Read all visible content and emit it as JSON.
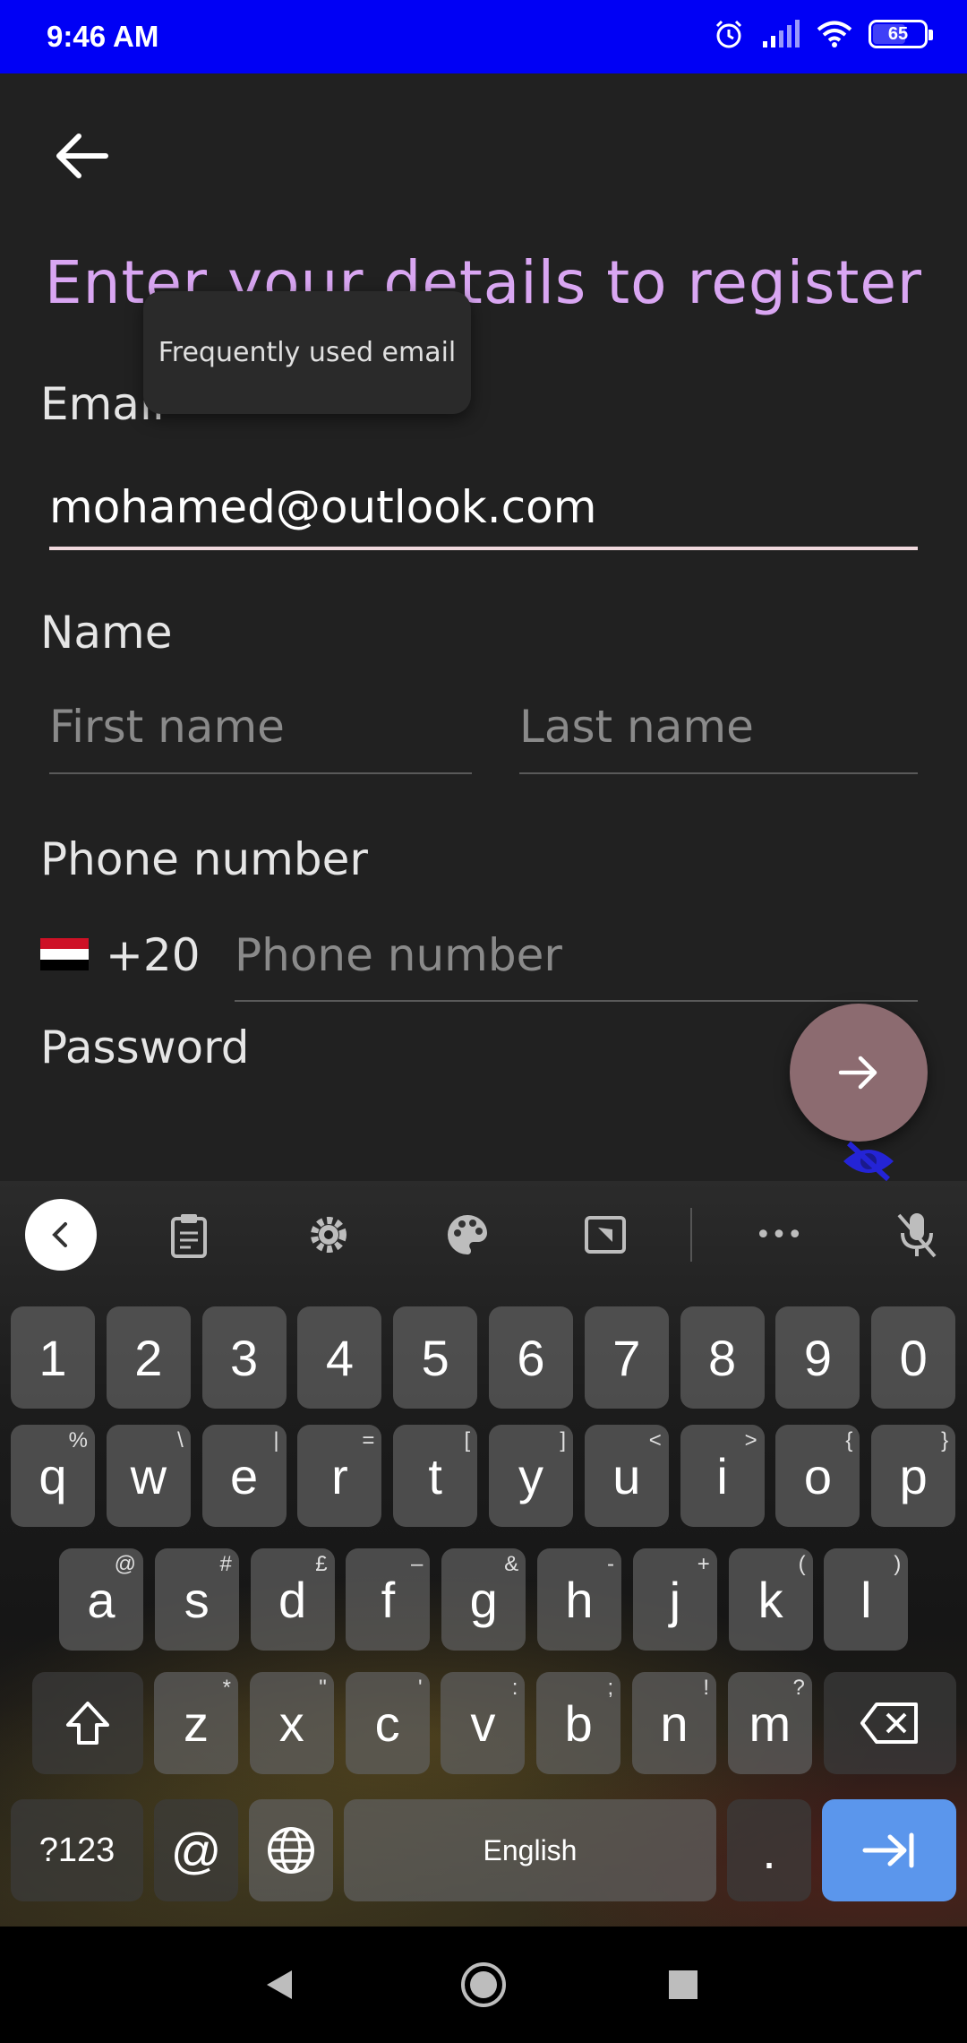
{
  "status_bar": {
    "time": "9:46 AM",
    "battery": "65",
    "battery_level": 0.65,
    "icons": [
      "alarm-icon",
      "signal-icon",
      "wifi-icon",
      "battery-icon"
    ]
  },
  "form": {
    "title": "Enter your details to register",
    "email_label": "Email",
    "email_value": "mohamed@outlook.com",
    "suggestion": "Frequently used email",
    "name_label": "Name",
    "first_name_placeholder": "First name",
    "last_name_placeholder": "Last name",
    "phone_label": "Phone number",
    "country_code": "+20",
    "phone_placeholder": "Phone number",
    "password_label": "Password",
    "colors": {
      "title": "#d9a6f2",
      "fab": "#8c6b70",
      "eye": "#2424d6"
    }
  },
  "keyboard": {
    "toolbar_icons": [
      "collapse-icon",
      "clipboard-icon",
      "settings-icon",
      "palette-icon",
      "resize-icon",
      "more-icon",
      "mic-off-icon"
    ],
    "more_label": "•••",
    "row_numbers": [
      "1",
      "2",
      "3",
      "4",
      "5",
      "6",
      "7",
      "8",
      "9",
      "0"
    ],
    "row1": [
      {
        "k": "q",
        "h": "%"
      },
      {
        "k": "w",
        "h": "\\"
      },
      {
        "k": "e",
        "h": "|"
      },
      {
        "k": "r",
        "h": "="
      },
      {
        "k": "t",
        "h": "["
      },
      {
        "k": "y",
        "h": "]"
      },
      {
        "k": "u",
        "h": "<"
      },
      {
        "k": "i",
        "h": ">"
      },
      {
        "k": "o",
        "h": "{"
      },
      {
        "k": "p",
        "h": "}"
      }
    ],
    "row2": [
      {
        "k": "a",
        "h": "@"
      },
      {
        "k": "s",
        "h": "#"
      },
      {
        "k": "d",
        "h": "£"
      },
      {
        "k": "f",
        "h": "–"
      },
      {
        "k": "g",
        "h": "&"
      },
      {
        "k": "h",
        "h": "-"
      },
      {
        "k": "j",
        "h": "+"
      },
      {
        "k": "k",
        "h": "("
      },
      {
        "k": "l",
        "h": ")"
      }
    ],
    "row3": [
      {
        "k": "z",
        "h": "*"
      },
      {
        "k": "x",
        "h": "\""
      },
      {
        "k": "c",
        "h": "'"
      },
      {
        "k": "v",
        "h": ":"
      },
      {
        "k": "b",
        "h": ";"
      },
      {
        "k": "n",
        "h": "!"
      },
      {
        "k": "m",
        "h": "?"
      }
    ],
    "symbols_label": "?123",
    "at_label": "@",
    "space_label": "English",
    "period_label": ".",
    "enter_color": "#5b96ec"
  },
  "nav_bar": {
    "icons": [
      "back-triangle-icon",
      "home-circle-icon",
      "recents-square-icon"
    ]
  }
}
